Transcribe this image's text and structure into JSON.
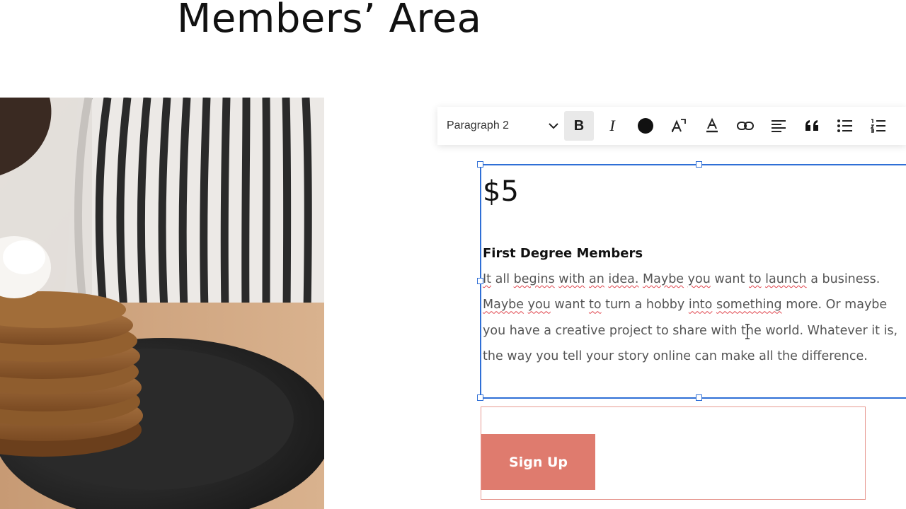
{
  "page": {
    "title": "Members’ Area"
  },
  "toolbar": {
    "style_select": "Paragraph 2",
    "bold": "B",
    "italic": "I",
    "buttons": [
      "chevron-down-icon",
      "bold-icon",
      "italic-icon",
      "text-color-icon",
      "text-size-icon",
      "highlight-icon",
      "link-icon",
      "align-left-icon",
      "quote-icon",
      "bulleted-list-icon",
      "numbered-list-icon"
    ]
  },
  "content": {
    "price": "$5",
    "member_title": "First Degree Members",
    "body": {
      "w1": "It",
      "w2": "all",
      "w3": "begins",
      "w4": "with",
      "w5": "an",
      "w6": "idea.",
      "w7": "Maybe",
      "w8": "you",
      "w9": "want",
      "w10": "to",
      "w11": "launch",
      "w12": "a",
      "w13": "business.",
      "w14": "Maybe",
      "w15": "you",
      "w16": "want",
      "w17": "to",
      "w18": "turn a hobby",
      "w19": "into",
      "w20": "something",
      "rest": "more. Or maybe you have a creative project to share with the world. Whatever it is, the way you tell your story online can make all the difference."
    }
  },
  "cta": {
    "signup_label": "Sign Up"
  },
  "colors": {
    "selection": "#2f6fd6",
    "button": "#df7b6e",
    "button_border": "#e79a92",
    "spellcheck": "#e0434b"
  }
}
